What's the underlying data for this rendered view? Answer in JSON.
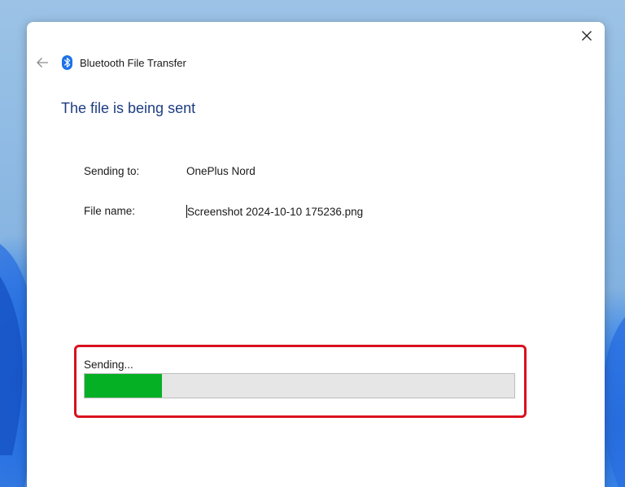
{
  "window": {
    "title": "Bluetooth File Transfer",
    "title_icon": "bluetooth-icon",
    "back_icon": "back-arrow-icon",
    "close_icon": "close-icon"
  },
  "heading": "The file is being sent",
  "details": {
    "sending_to_label": "Sending to:",
    "sending_to_value": "OnePlus Nord",
    "file_name_label": "File name:",
    "file_name_value": "Screenshot 2024-10-10 175236.png"
  },
  "progress": {
    "status_label": "Sending...",
    "fraction": 0.18,
    "fill_color": "#06b025"
  },
  "colors": {
    "heading": "#1e3d80",
    "bluetooth_icon": "#1a73e8",
    "highlight_border": "#d9101e"
  }
}
